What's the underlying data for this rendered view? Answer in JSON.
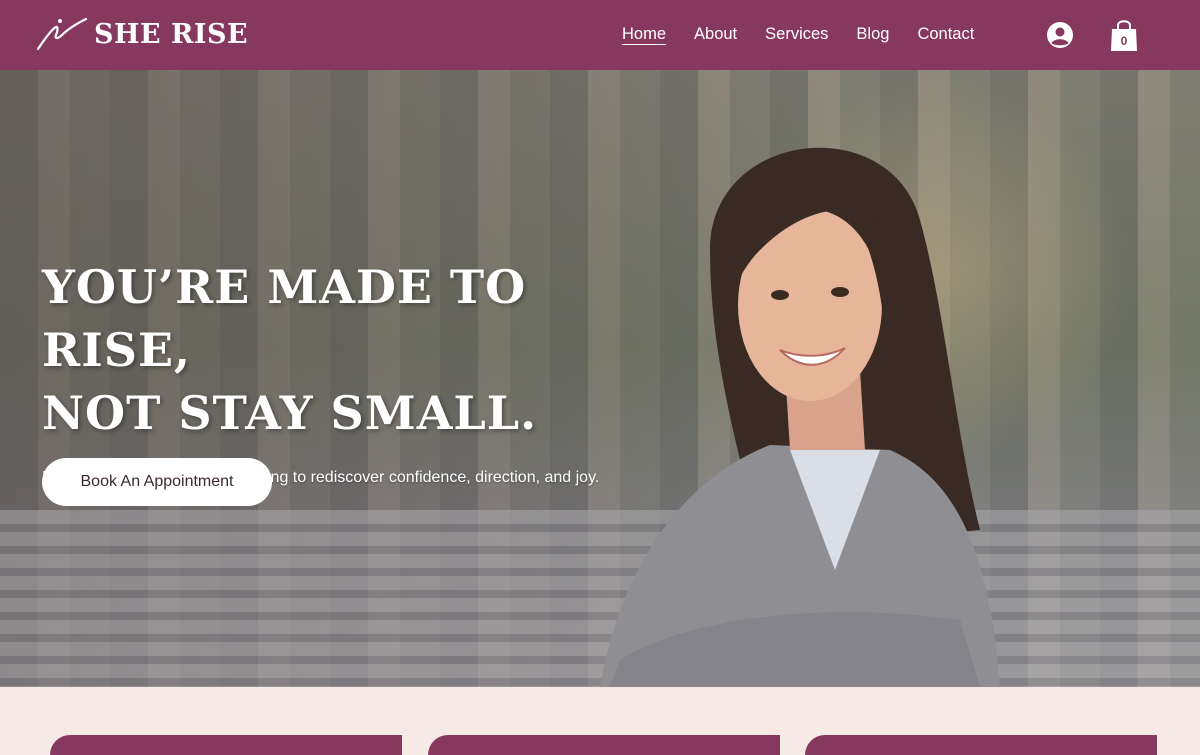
{
  "brand": {
    "name": "SHE RISE",
    "logo_icon": "signature-swoosh-icon",
    "color": "#86385f"
  },
  "nav": {
    "items": [
      {
        "label": "Home",
        "active": true
      },
      {
        "label": "About",
        "active": false
      },
      {
        "label": "Services",
        "active": false
      },
      {
        "label": "Blog",
        "active": false
      },
      {
        "label": "Contact",
        "active": false
      }
    ]
  },
  "account": {
    "icon": "user-circle-icon"
  },
  "cart": {
    "icon": "shopping-bag-icon",
    "count": "0"
  },
  "hero": {
    "title_line1": "YOU’RE MADE TO RISE,",
    "title_line2": "NOT STAY SMALL.",
    "subtitle": "Empowering women with coaching to rediscover confidence, direction, and joy.",
    "cta_label": "Book An Appointment"
  }
}
